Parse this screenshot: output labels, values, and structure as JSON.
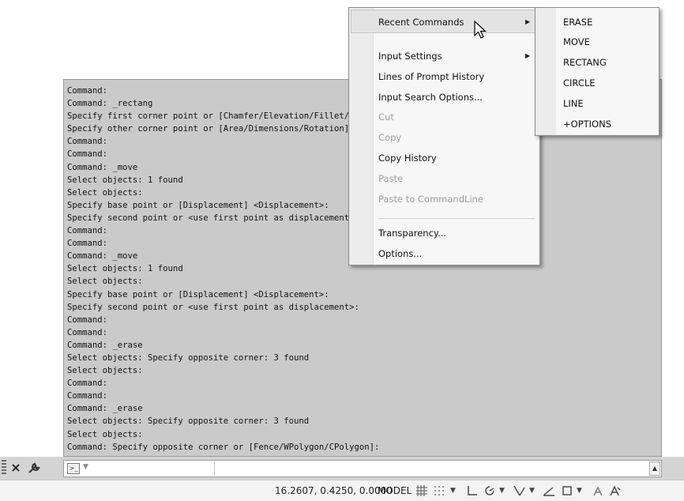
{
  "command_history": [
    "Command:",
    "Command: _rectang",
    "Specify first corner point or [Chamfer/Elevation/Fillet/Thickness/Width]:",
    "Specify other corner point or [Area/Dimensions/Rotation]:",
    "Command:",
    "Command:",
    "Command: _move",
    "Select objects: 1 found",
    "Select objects:",
    "Specify base point or [Displacement] <Displacement>:",
    "Specify second point or <use first point as displacement>:",
    "Command:",
    "Command:",
    "Command: _move",
    "Select objects: 1 found",
    "Select objects:",
    "Specify base point or [Displacement] <Displacement>:",
    "Specify second point or <use first point as displacement>:",
    "Command:",
    "Command:",
    "Command: _erase",
    "Select objects: Specify opposite corner: 3 found",
    "Select objects:",
    "Command:",
    "Command:",
    "Command: _erase",
    "Select objects: Specify opposite corner: 3 found",
    "Select objects:",
    "Command: Specify opposite corner or [Fence/WPolygon/CPolygon]:"
  ],
  "context_menu": {
    "recent_commands": "Recent Commands",
    "input_settings": "Input Settings",
    "lines_of_history": "Lines of Prompt History",
    "input_search": "Input Search Options...",
    "cut": "Cut",
    "copy": "Copy",
    "copy_history": "Copy History",
    "paste": "Paste",
    "paste_to_cmdline": "Paste to CommandLine",
    "transparency": "Transparency...",
    "options": "Options..."
  },
  "recent_commands_submenu": [
    "ERASE",
    "MOVE",
    "RECTANG",
    "CIRCLE",
    "LINE",
    "+OPTIONS"
  ],
  "command_line": {
    "close_icon": "×"
  },
  "status_bar": {
    "coordinates": "16.2607, 0.4250, 0.0000",
    "model": "MODEL"
  }
}
